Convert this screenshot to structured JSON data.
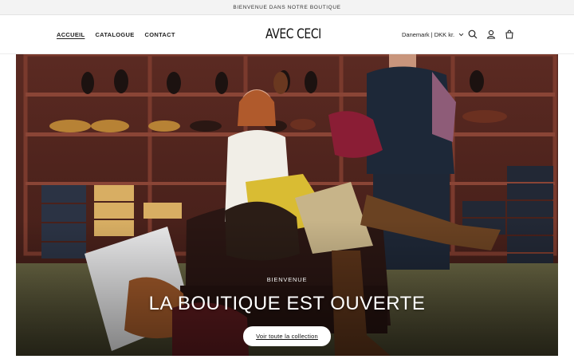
{
  "announcement": {
    "text": "BIENVENUE DANS NOTRE BOUTIQUE"
  },
  "header": {
    "nav": [
      {
        "label": "ACCUEIL",
        "active": true
      },
      {
        "label": "CATALOGUE",
        "active": false
      },
      {
        "label": "CONTACT",
        "active": false
      }
    ],
    "logo": "AVEC CECI",
    "locale": "Danemark | DKK kr.",
    "icons": [
      "search-icon",
      "account-icon",
      "cart-icon"
    ]
  },
  "hero": {
    "kicker": "BIENVENUE",
    "headline": "LA BOUTIQUE EST OUVERTE",
    "cta_label": "Voir toute la collection"
  }
}
